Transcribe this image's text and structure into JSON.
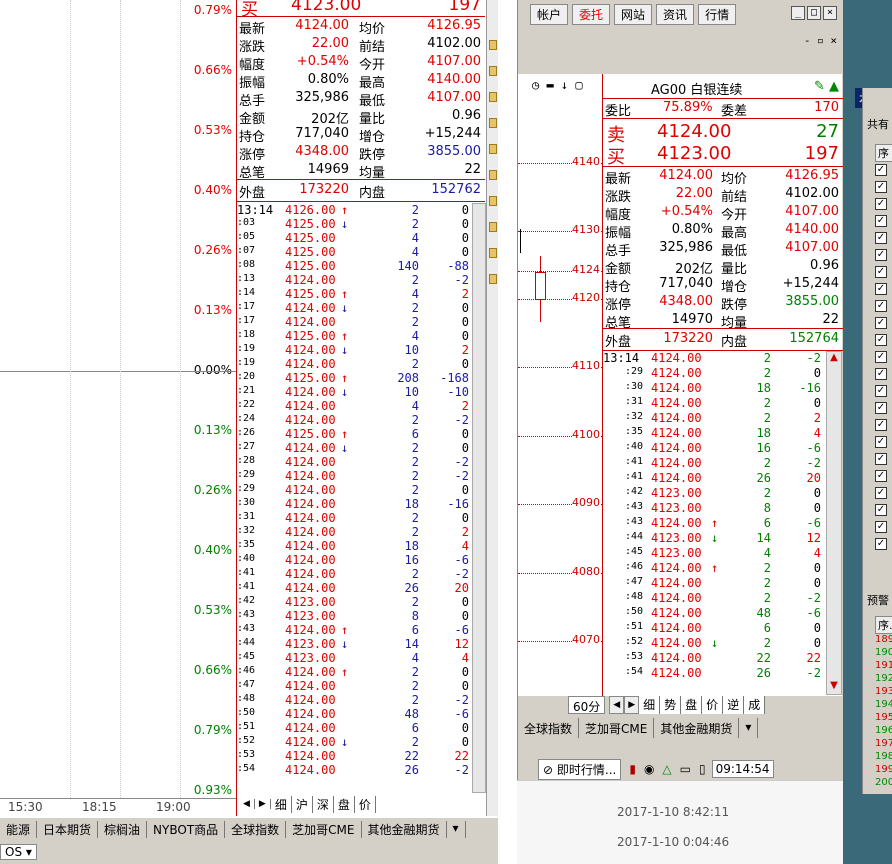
{
  "left_chart": {
    "pct_labels": [
      "0.79%",
      "0.66%",
      "0.53%",
      "0.40%",
      "0.26%",
      "0.13%",
      "0.00%",
      "0.13%",
      "0.26%",
      "0.40%",
      "0.53%",
      "0.66%",
      "0.79%",
      "0.93%"
    ],
    "time_labels": [
      "15:30",
      "18:15",
      "19:00"
    ]
  },
  "left_quote": {
    "top_sell": {
      "label": "买",
      "price": "4123.00",
      "vol": "197"
    },
    "rows": [
      [
        "最新",
        "4124.00",
        "均价",
        "4126.95"
      ],
      [
        "涨跌",
        "22.00",
        "前结",
        "4102.00"
      ],
      [
        "幅度",
        "+0.54%",
        "今开",
        "4107.00"
      ],
      [
        "振幅",
        "0.80%",
        "最高",
        "4140.00"
      ],
      [
        "总手",
        "325,986",
        "最低",
        "4107.00"
      ],
      [
        "金额",
        "202亿",
        "量比",
        "0.96"
      ],
      [
        "持仓",
        "717,040",
        "增仓",
        "+15,244"
      ],
      [
        "涨停",
        "4348.00",
        "跌停",
        "3855.00"
      ],
      [
        "总笔",
        "14969",
        "均量",
        "22"
      ]
    ],
    "outer": {
      "label": "外盘",
      "value": "173220",
      "inner_label": "内盘",
      "inner_value": "152762"
    },
    "ticks": [
      [
        "13:14",
        "4126.00",
        "↑",
        "2",
        "0"
      ],
      [
        ":03",
        "4125.00",
        "↓",
        "2",
        "0"
      ],
      [
        ":05",
        "4125.00",
        "",
        "4",
        "0"
      ],
      [
        ":07",
        "4125.00",
        "",
        "4",
        "0"
      ],
      [
        ":08",
        "4125.00",
        "",
        "140",
        "-88"
      ],
      [
        ":13",
        "4124.00",
        "",
        "2",
        "-2"
      ],
      [
        ":14",
        "4125.00",
        "↑",
        "4",
        "2"
      ],
      [
        ":17",
        "4124.00",
        "↓",
        "2",
        "0"
      ],
      [
        ":17",
        "4124.00",
        "",
        "2",
        "0"
      ],
      [
        ":18",
        "4125.00",
        "↑",
        "4",
        "0"
      ],
      [
        ":19",
        "4124.00",
        "↓",
        "10",
        "2"
      ],
      [
        ":19",
        "4124.00",
        "",
        "2",
        "0"
      ],
      [
        ":20",
        "4125.00",
        "↑",
        "208",
        "-168"
      ],
      [
        ":21",
        "4124.00",
        "↓",
        "10",
        "-10"
      ],
      [
        ":22",
        "4124.00",
        "",
        "4",
        "2"
      ],
      [
        ":24",
        "4124.00",
        "",
        "2",
        "-2"
      ],
      [
        ":26",
        "4125.00",
        "↑",
        "6",
        "0"
      ],
      [
        ":27",
        "4124.00",
        "↓",
        "2",
        "0"
      ],
      [
        ":28",
        "4124.00",
        "",
        "2",
        "-2"
      ],
      [
        ":29",
        "4124.00",
        "",
        "2",
        "-2"
      ],
      [
        ":29",
        "4124.00",
        "",
        "2",
        "0"
      ],
      [
        ":30",
        "4124.00",
        "",
        "18",
        "-16"
      ],
      [
        ":31",
        "4124.00",
        "",
        "2",
        "0"
      ],
      [
        ":32",
        "4124.00",
        "",
        "2",
        "2"
      ],
      [
        ":35",
        "4124.00",
        "",
        "18",
        "4"
      ],
      [
        ":40",
        "4124.00",
        "",
        "16",
        "-6"
      ],
      [
        ":41",
        "4124.00",
        "",
        "2",
        "-2"
      ],
      [
        ":41",
        "4124.00",
        "",
        "26",
        "20"
      ],
      [
        ":42",
        "4123.00",
        "",
        "2",
        "0"
      ],
      [
        ":43",
        "4123.00",
        "",
        "8",
        "0"
      ],
      [
        ":43",
        "4124.00",
        "↑",
        "6",
        "-6"
      ],
      [
        ":44",
        "4123.00",
        "↓",
        "14",
        "12"
      ],
      [
        ":45",
        "4123.00",
        "",
        "4",
        "4"
      ],
      [
        ":46",
        "4124.00",
        "↑",
        "2",
        "0"
      ],
      [
        ":47",
        "4124.00",
        "",
        "2",
        "0"
      ],
      [
        ":48",
        "4124.00",
        "",
        "2",
        "-2"
      ],
      [
        ":50",
        "4124.00",
        "",
        "48",
        "-6"
      ],
      [
        ":51",
        "4124.00",
        "",
        "6",
        "0"
      ],
      [
        ":52",
        "4124.00",
        "↓",
        "2",
        "0"
      ],
      [
        ":53",
        "4124.00",
        "",
        "22",
        "22"
      ],
      [
        ":54",
        "4124.00",
        "",
        "26",
        "-2"
      ]
    ],
    "bottom_tabs": [
      "细",
      "沪",
      "深",
      "盘",
      "价"
    ]
  },
  "right_window": {
    "menu": [
      "帐户",
      "委托",
      "网站",
      "资讯",
      "行情"
    ],
    "title": "AG00 白银连续",
    "weibi": {
      "label": "委比",
      "value": "75.89%",
      "label2": "委差",
      "value2": "170"
    },
    "sell": {
      "label": "卖",
      "price": "4124.00",
      "vol": "27"
    },
    "buy": {
      "label": "买",
      "price": "4123.00",
      "vol": "197"
    },
    "rows": [
      [
        "最新",
        "4124.00",
        "均价",
        "4126.95"
      ],
      [
        "涨跌",
        "22.00",
        "前结",
        "4102.00"
      ],
      [
        "幅度",
        "+0.54%",
        "今开",
        "4107.00"
      ],
      [
        "振幅",
        "0.80%",
        "最高",
        "4140.00"
      ],
      [
        "总手",
        "325,986",
        "最低",
        "4107.00"
      ],
      [
        "金额",
        "202亿",
        "量比",
        "0.96"
      ],
      [
        "持仓",
        "717,040",
        "增仓",
        "+15,244"
      ],
      [
        "涨停",
        "4348.00",
        "跌停",
        "3855.00"
      ],
      [
        "总笔",
        "14970",
        "均量",
        "22"
      ]
    ],
    "outer": {
      "label": "外盘",
      "value": "173220",
      "inner_label": "内盘",
      "inner_value": "152764"
    },
    "price_axis": [
      "4140",
      "4130",
      "4124",
      "4120",
      "4110",
      "4100",
      "4090",
      "4080",
      "4070"
    ],
    "ticks": [
      [
        "13:14",
        "4124.00",
        "",
        "2",
        "-2"
      ],
      [
        ":29",
        "4124.00",
        "",
        "2",
        "0"
      ],
      [
        ":30",
        "4124.00",
        "",
        "18",
        "-16"
      ],
      [
        ":31",
        "4124.00",
        "",
        "2",
        "0"
      ],
      [
        ":32",
        "4124.00",
        "",
        "2",
        "2"
      ],
      [
        ":35",
        "4124.00",
        "",
        "18",
        "4"
      ],
      [
        ":40",
        "4124.00",
        "",
        "16",
        "-6"
      ],
      [
        ":41",
        "4124.00",
        "",
        "2",
        "-2"
      ],
      [
        ":41",
        "4124.00",
        "",
        "26",
        "20"
      ],
      [
        ":42",
        "4123.00",
        "",
        "2",
        "0"
      ],
      [
        ":43",
        "4123.00",
        "",
        "8",
        "0"
      ],
      [
        ":43",
        "4124.00",
        "↑",
        "6",
        "-6"
      ],
      [
        ":44",
        "4123.00",
        "↓",
        "14",
        "12"
      ],
      [
        ":45",
        "4123.00",
        "",
        "4",
        "4"
      ],
      [
        ":46",
        "4124.00",
        "↑",
        "2",
        "0"
      ],
      [
        ":47",
        "4124.00",
        "",
        "2",
        "0"
      ],
      [
        ":48",
        "4124.00",
        "",
        "2",
        "-2"
      ],
      [
        ":50",
        "4124.00",
        "",
        "48",
        "-6"
      ],
      [
        ":51",
        "4124.00",
        "",
        "6",
        "0"
      ],
      [
        ":52",
        "4124.00",
        "↓",
        "2",
        "0"
      ],
      [
        ":53",
        "4124.00",
        "",
        "22",
        "22"
      ],
      [
        ":54",
        "4124.00",
        "",
        "26",
        "-2"
      ]
    ],
    "period": "60分",
    "bottom_tabs": [
      "细",
      "势",
      "盘",
      "价",
      "逆",
      "成"
    ],
    "market_tabs": [
      "全球指数",
      "芝加哥CME",
      "其他金融期货"
    ],
    "status": {
      "label": "即时行情...",
      "time": "09:14:54"
    }
  },
  "left_bottom": {
    "market_tabs": [
      "能源",
      "日本期货",
      "棕榈油",
      "NYBOT商品",
      "全球指数",
      "芝加哥CME",
      "其他金融期货"
    ],
    "os_label": "OS"
  },
  "log": [
    "2017-1-10 8:42:11",
    "2017-1-10 0:04:46"
  ],
  "far_right": {
    "header": "本",
    "label1": "共有",
    "col_header": "序",
    "alert_label": "预警",
    "alert_col": "序.",
    "alert_nums": [
      "189",
      "190",
      "191",
      "192",
      "193",
      "194",
      "195",
      "196",
      "197",
      "198",
      "199",
      "200"
    ]
  }
}
